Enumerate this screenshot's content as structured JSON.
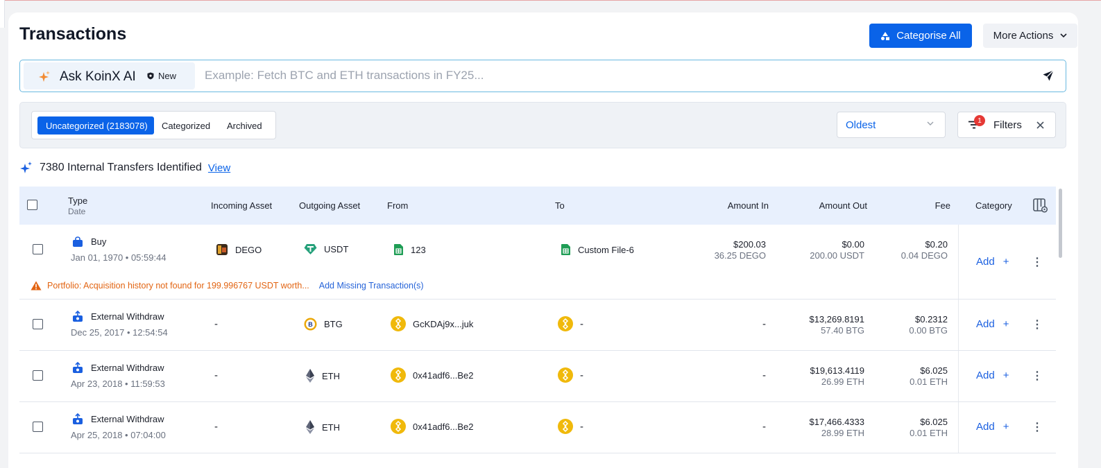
{
  "header": {
    "title": "Transactions",
    "categorise_all": "Categorise All",
    "more_actions": "More Actions"
  },
  "ai": {
    "label": "Ask KoinX AI",
    "badge": "New",
    "placeholder": "Example: Fetch BTC and ETH transactions in FY25..."
  },
  "tabs": [
    {
      "label": "Uncategorized (2183078)",
      "active": true
    },
    {
      "label": "Categorized",
      "active": false
    },
    {
      "label": "Archived",
      "active": false
    }
  ],
  "sort": {
    "value": "Oldest"
  },
  "filters": {
    "label": "Filters",
    "count": "1"
  },
  "internal": {
    "text": "7380 Internal Transfers Identified",
    "link": "View"
  },
  "table": {
    "columns": {
      "type": "Type",
      "date": "Date",
      "incoming": "Incoming Asset",
      "outgoing": "Outgoing Asset",
      "from": "From",
      "to": "To",
      "amount_in": "Amount In",
      "amount_out": "Amount Out",
      "fee": "Fee",
      "category": "Category"
    },
    "add_label": "Add",
    "rows": [
      {
        "type": "Buy",
        "date": "Jan 01, 1970 • 05:59:44",
        "incoming": "DEGO",
        "outgoing": "USDT",
        "from": "123",
        "to": "Custom File-6",
        "amount_in": "$200.03",
        "amount_in_sub": "36.25 DEGO",
        "amount_out": "$0.00",
        "amount_out_sub": "200.00 USDT",
        "fee": "$0.20",
        "fee_sub": "0.04 DEGO",
        "warning": "Portfolio: Acquisition history not found for 199.996767 USDT worth...",
        "warning_link": "Add Missing Transaction(s)"
      },
      {
        "type": "External Withdraw",
        "date": "Dec 25, 2017 • 12:54:54",
        "incoming": "-",
        "outgoing": "BTG",
        "from": "GcKDAj9x...juk",
        "to": "-",
        "amount_in": "-",
        "amount_out": "$13,269.8191",
        "amount_out_sub": "57.40 BTG",
        "fee": "$0.2312",
        "fee_sub": "0.00 BTG"
      },
      {
        "type": "External Withdraw",
        "date": "Apr 23, 2018 • 11:59:53",
        "incoming": "-",
        "outgoing": "ETH",
        "from": "0x41adf6...Be2",
        "to": "-",
        "amount_in": "-",
        "amount_out": "$19,613.4119",
        "amount_out_sub": "26.99 ETH",
        "fee": "$6.025",
        "fee_sub": "0.01 ETH"
      },
      {
        "type": "External Withdraw",
        "date": "Apr 25, 2018 • 07:04:00",
        "incoming": "-",
        "outgoing": "ETH",
        "from": "0x41adf6...Be2",
        "to": "-",
        "amount_in": "-",
        "amount_out": "$17,466.4333",
        "amount_out_sub": "28.99 ETH",
        "fee": "$6.025",
        "fee_sub": "0.01 ETH"
      }
    ]
  },
  "colors": {
    "accent": "#0a63e8",
    "warning": "#e26412",
    "header_bg": "#e8f0fd"
  }
}
